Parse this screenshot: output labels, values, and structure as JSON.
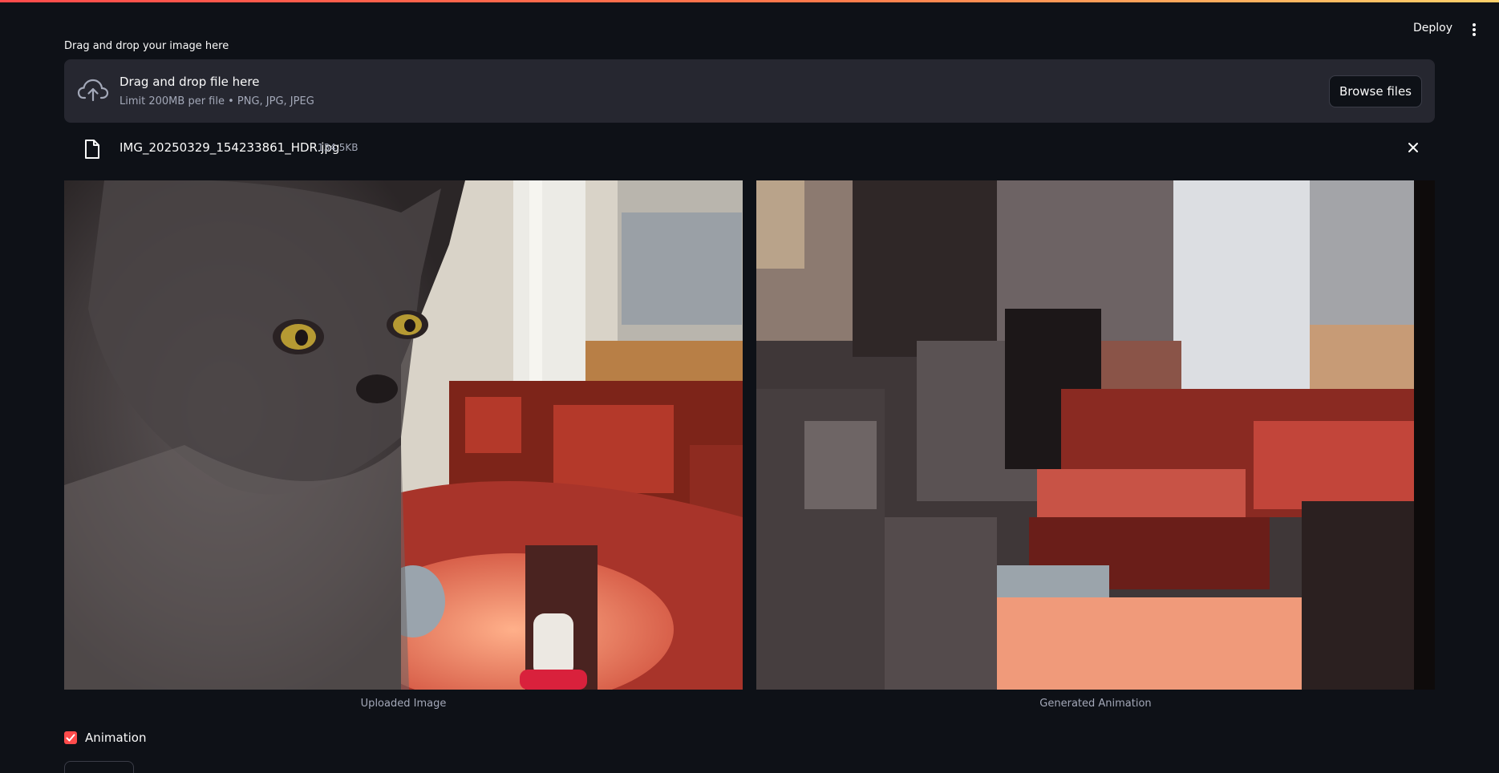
{
  "header": {
    "deploy_label": "Deploy"
  },
  "uploader": {
    "label": "Drag and drop your image here",
    "dropzone_title": "Drag and drop file here",
    "dropzone_subtitle": "Limit 200MB per file • PNG, JPG, JPEG",
    "browse_label": "Browse files"
  },
  "file": {
    "name": "IMG_20250329_154233861_HDR.jpg",
    "size": "134.5KB"
  },
  "images": {
    "left_caption": "Uploaded Image",
    "right_caption": "Generated Animation"
  },
  "controls": {
    "animation_label": "Animation",
    "animation_checked": true
  },
  "colors": {
    "accent": "#ff4b4b",
    "background": "#0e1117",
    "panel": "#262730",
    "muted_text": "#a3a8b8"
  },
  "icons": [
    "cloud-upload-icon",
    "file-icon",
    "close-icon",
    "more-vertical-icon",
    "check-icon"
  ]
}
